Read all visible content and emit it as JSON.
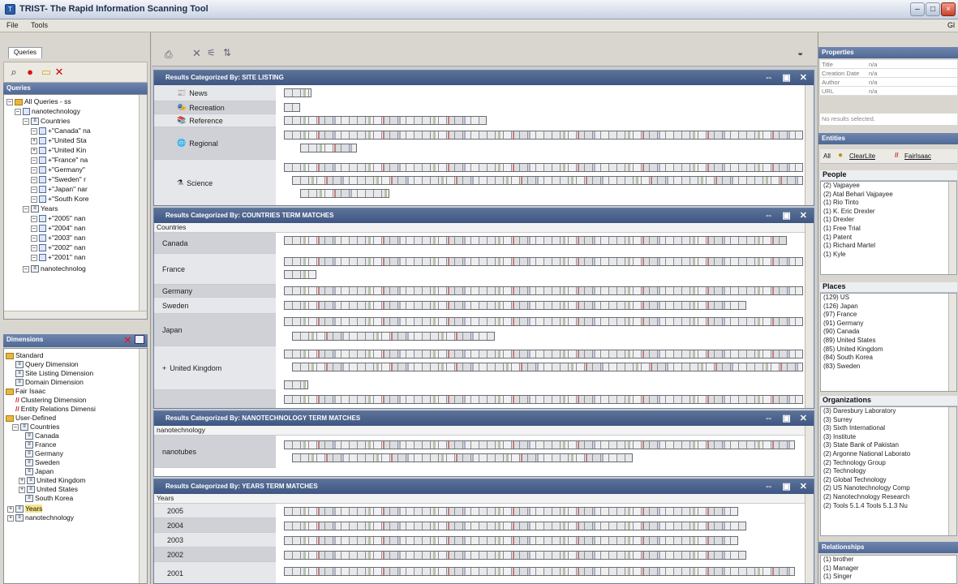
{
  "window": {
    "title": "TRIST- The Rapid Information Scanning Tool",
    "icon_name": "app-icon"
  },
  "menu": {
    "file": "File",
    "tools": "Tools",
    "right": "Gl"
  },
  "left": {
    "tab_label": "Queries",
    "queries_header": "Queries",
    "query_tree": [
      "All Queries - ss",
      "nanotechnology",
      "Countries",
      "+\"Canada\" na",
      "+\"United Sta",
      "+\"United Kin",
      "+\"France\" na",
      "+\"Germany\" ",
      "+\"Sweden\" r",
      "+\"Japan\" nar",
      "+\"South Kore",
      "Years",
      "+\"2005\" nan",
      "+\"2004\" nan",
      "+\"2003\" nan",
      "+\"2002\" nan",
      "+\"2001\" nan",
      "nanotechnolog"
    ],
    "dimensions_header": "Dimensions",
    "dimension_tree": [
      {
        "label": "Standard",
        "type": "folder"
      },
      {
        "label": "Query Dimension",
        "type": "dim"
      },
      {
        "label": "Site Listing Dimension",
        "type": "dim"
      },
      {
        "label": "Domain Dimension",
        "type": "dim"
      },
      {
        "label": "Fair Isaac",
        "type": "folder"
      },
      {
        "label": "Clustering Dimension",
        "type": "dim2"
      },
      {
        "label": "Entity Relations Dimensi",
        "type": "dim2"
      },
      {
        "label": "User-Defined",
        "type": "folder"
      },
      {
        "label": "Countries",
        "type": "dim"
      },
      {
        "label": "Canada",
        "type": "sub"
      },
      {
        "label": "France",
        "type": "sub"
      },
      {
        "label": "Germany",
        "type": "sub"
      },
      {
        "label": "Sweden",
        "type": "sub"
      },
      {
        "label": "Japan",
        "type": "sub"
      },
      {
        "label": "United Kingdom",
        "type": "sub"
      },
      {
        "label": "United States",
        "type": "sub"
      },
      {
        "label": "South Korea",
        "type": "sub"
      },
      {
        "label": "Years",
        "type": "dim"
      },
      {
        "label": "nanotechnology",
        "type": "dim"
      }
    ]
  },
  "panels": {
    "site": {
      "title": "Results Categorized By:  SITE LISTING",
      "rows": [
        {
          "label": "News",
          "icon": "news-icon"
        },
        {
          "label": "Recreation",
          "icon": "recreation-icon"
        },
        {
          "label": "Reference",
          "icon": "reference-icon"
        },
        {
          "label": "Regional",
          "icon": "globe-icon"
        },
        {
          "label": "Science",
          "icon": "flask-icon"
        }
      ]
    },
    "countries": {
      "title": "Results Categorized By:  COUNTRIES TERM MATCHES",
      "header": "Countries",
      "rows": [
        "Canada",
        "France",
        "Germany",
        "Sweden",
        "Japan",
        "United Kingdom",
        ""
      ]
    },
    "nano": {
      "title": "Results Categorized By:  NANOTECHNOLOGY TERM MATCHES",
      "header": "nanotechnology",
      "rows": [
        "nanotubes"
      ]
    },
    "years": {
      "title": "Results Categorized By:  YEARS TERM MATCHES",
      "header": "Years",
      "rows": [
        "2005",
        "2004",
        "2003",
        "2002",
        "2001"
      ]
    }
  },
  "right": {
    "properties_header": "Properties",
    "properties": [
      {
        "key": "Title",
        "value": "n/a"
      },
      {
        "key": "Creation Date",
        "value": "n/a"
      },
      {
        "key": "Author",
        "value": "n/a"
      },
      {
        "key": "URL",
        "value": "n/a"
      }
    ],
    "no_results": "No results selected.",
    "entities_header": "Entities",
    "entity_tabs": {
      "all": "All",
      "clear_lite": "ClearLite",
      "fair_isaac": "FairIsaac"
    },
    "people_header": "People",
    "people": [
      "(2) Vajpayee",
      "(2) Atal Behari Vajpayee",
      "(1) Rio Tinto",
      "(1) K. Eric Drexler",
      "(1) Drexler",
      "(1) Free Trial",
      "(1) Patent",
      "(1) Richard Martel",
      "(1) Kyle"
    ],
    "places_header": "Places",
    "places": [
      "(129) US",
      "(126) Japan",
      "(97) France",
      "(91) Germany",
      "(90) Canada",
      "(89) United States",
      "(85) United Kingdom",
      "(84) South Korea",
      "(83) Sweden"
    ],
    "orgs_header": "Organizations",
    "orgs": [
      "(3) Daresbury Laboratory",
      "(3) Surrey",
      "(3) Sixth International",
      "(3) Institute",
      "(3) State Bank of Pakistan",
      "(2) Argonne National Laborato",
      "(2) Technology Group",
      "(2) Technology",
      "(2) Global Technology",
      "(2) US Nanotechnology Comp",
      "(2) Nanotechnology Research",
      "(2) Tools 5.1.4 Tools 5.1.3 Nu"
    ],
    "relations_header": "Relationships",
    "relations": [
      "(1) brother",
      "(1) Manager",
      "(1) Singer"
    ]
  }
}
